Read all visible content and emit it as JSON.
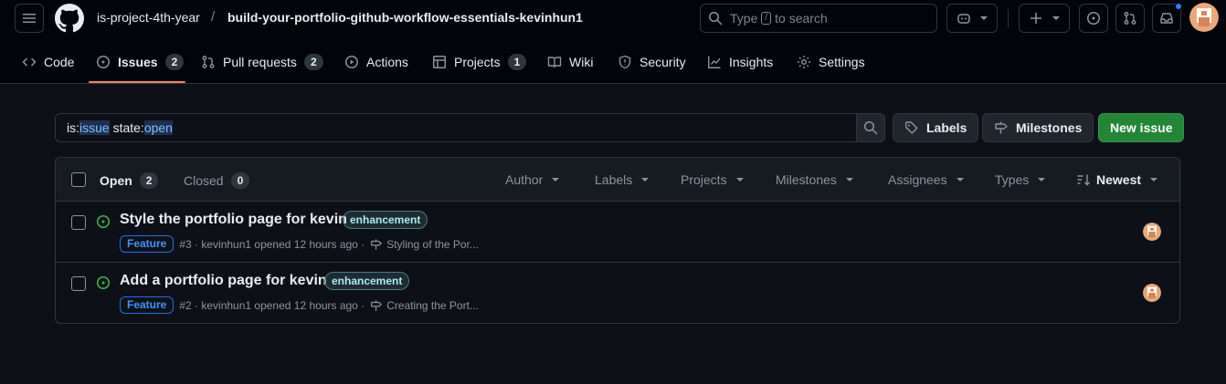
{
  "header": {
    "owner": "is-project-4th-year",
    "separator": "/",
    "repo": "build-your-portfolio-github-workflow-essentials-kevinhun1",
    "search": {
      "prefix": "Type",
      "key": "/",
      "suffix": "to search"
    }
  },
  "nav": {
    "code": "Code",
    "issues": "Issues",
    "issues_count": "2",
    "pulls": "Pull requests",
    "pulls_count": "2",
    "actions": "Actions",
    "projects": "Projects",
    "projects_count": "1",
    "wiki": "Wiki",
    "security": "Security",
    "insights": "Insights",
    "settings": "Settings"
  },
  "filter": {
    "k1": "is:",
    "v1": "issue",
    "k2": " state:",
    "v2": "open"
  },
  "buttons": {
    "labels": "Labels",
    "milestones": "Milestones",
    "new_issue": "New issue"
  },
  "list_header": {
    "open_label": "Open",
    "open_count": "2",
    "closed_label": "Closed",
    "closed_count": "0",
    "filters": [
      "Author",
      "Labels",
      "Projects",
      "Milestones",
      "Assignees",
      "Types"
    ],
    "sort": "Newest"
  },
  "issues": [
    {
      "title": "Style the portfolio page for kevin",
      "label": "enhancement",
      "type": "Feature",
      "meta": "#3 · kevinhun1 opened 12 hours ago ·",
      "milestone": "Styling of the Por..."
    },
    {
      "title": "Add a portfolio page for kevin",
      "label": "enhancement",
      "type": "Feature",
      "meta": "#2 · kevinhun1 opened 12 hours ago ·",
      "milestone": "Creating the Port..."
    }
  ],
  "colors": {
    "bg": "#0d1117",
    "header_bg": "#010409",
    "accent_underline": "#f78166",
    "primary_button": "#238636",
    "open_state": "#3fb950",
    "notification_dot": "#2f81f7"
  }
}
